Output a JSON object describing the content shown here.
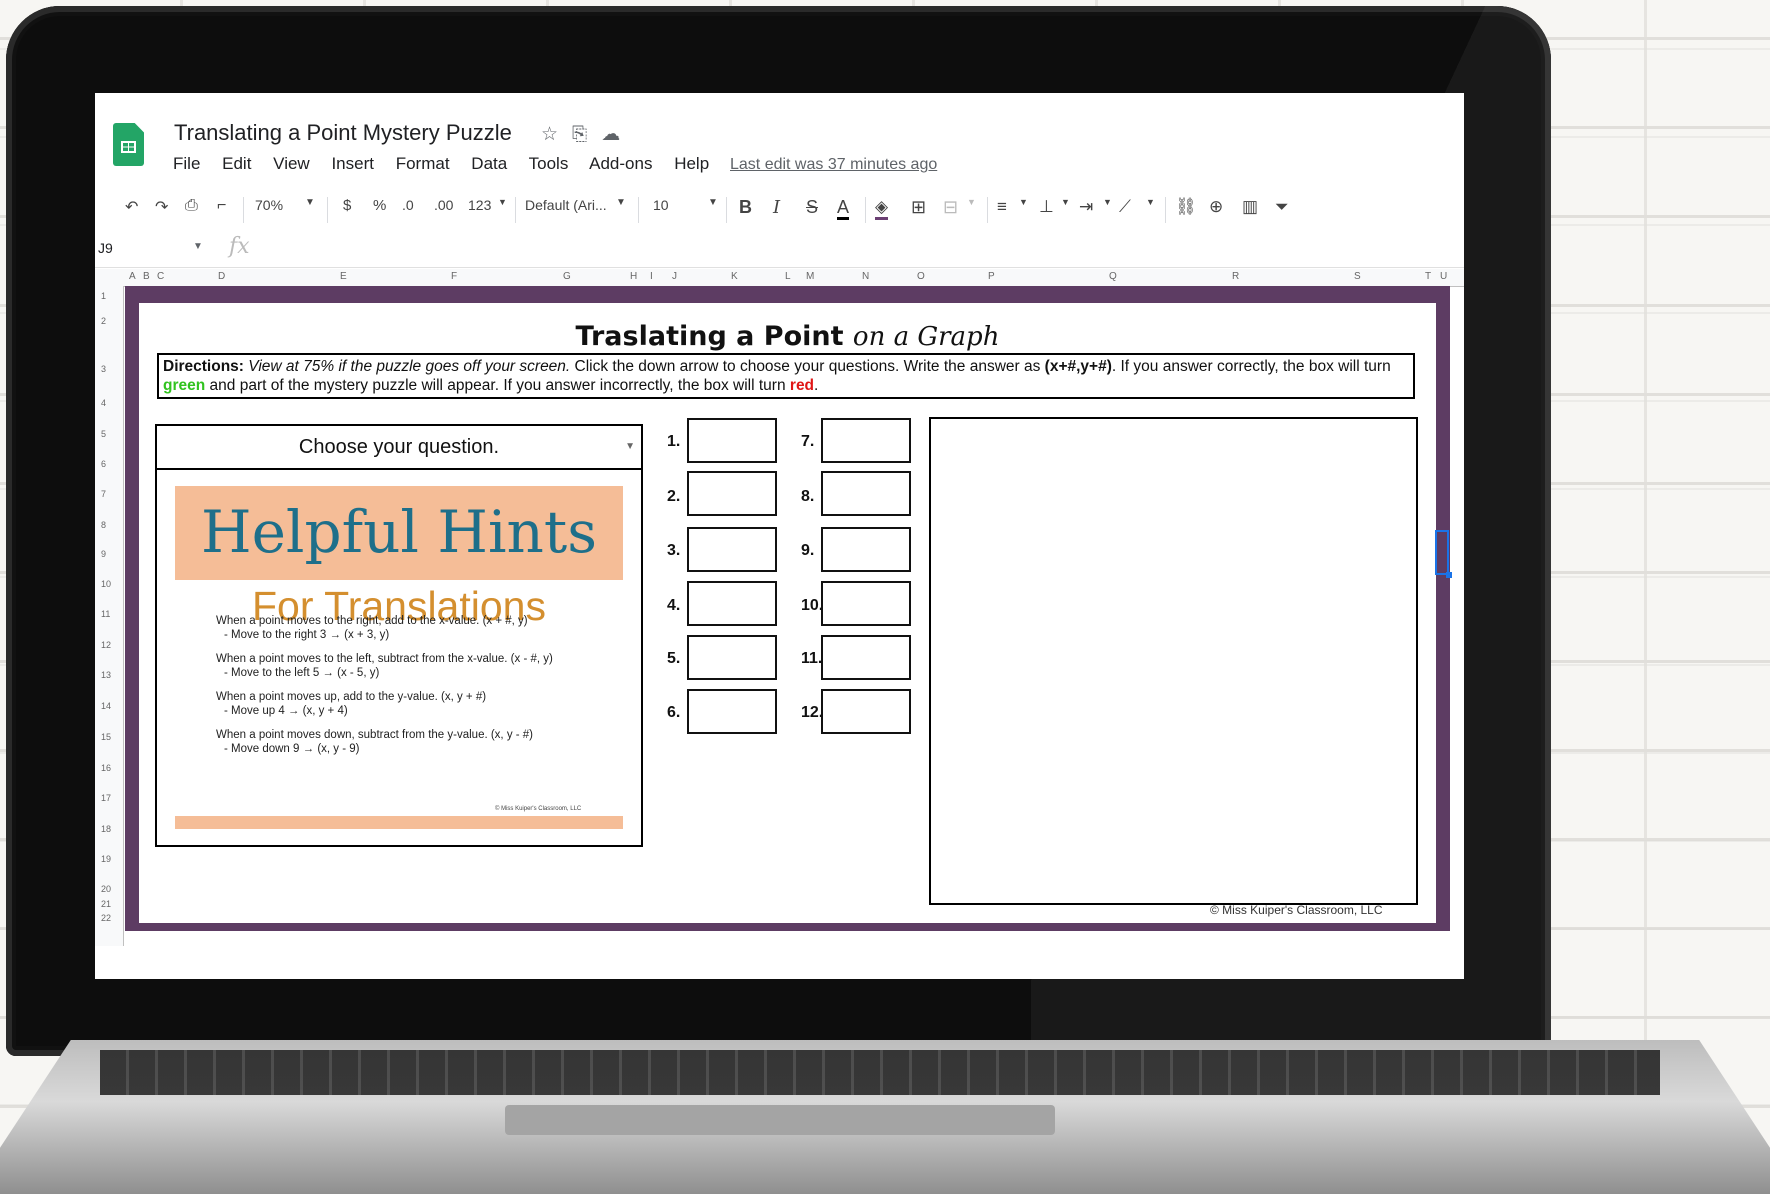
{
  "app": {
    "doc_title": "Translating a Point Mystery Puzzle",
    "title_icons": [
      "star-icon",
      "move-folder-icon",
      "cloud-status-icon"
    ],
    "menus": [
      "File",
      "Edit",
      "View",
      "Insert",
      "Format",
      "Data",
      "Tools",
      "Add-ons",
      "Help"
    ],
    "last_edit": "Last edit was 37 minutes ago"
  },
  "toolbar": {
    "zoom": "70%",
    "currency": "$",
    "percent": "%",
    "decrease_decimal": ".0",
    "increase_decimal": ".00",
    "more_formats": "123",
    "font": "Default (Ari...",
    "font_size": "10",
    "bold": "B",
    "italic": "I",
    "strike": "S",
    "text_color": "A",
    "fill_color": "#6b3f73"
  },
  "formula_bar": {
    "cell_ref": "J9",
    "fx": "fx",
    "value": ""
  },
  "grid": {
    "columns": [
      "A",
      "B",
      "C",
      "D",
      "E",
      "F",
      "G",
      "H",
      "I",
      "J",
      "K",
      "L",
      "M",
      "N",
      "O",
      "P",
      "Q",
      "R",
      "S",
      "T",
      "U"
    ],
    "rows": [
      "1",
      "2",
      "3",
      "4",
      "5",
      "6",
      "7",
      "8",
      "9",
      "10",
      "11",
      "12",
      "13",
      "14",
      "15",
      "16",
      "17",
      "18",
      "19",
      "20",
      "21",
      "22"
    ]
  },
  "puzzle": {
    "title_main": "Traslating a Point",
    "title_script": "on a Graph",
    "directions": {
      "label": "Directions:",
      "italic": "View at 75% if the puzzle goes off your screen.",
      "text1": "Click the down arrow to choose your questions. Write the answer as",
      "format": "(x+#,y+#)",
      "text2": ". If you answer correctly, the box will turn",
      "green": "green",
      "text3": "and part of the mystery puzzle will appear. If you answer incorrectly, the box will turn",
      "red": "red",
      "end": "."
    },
    "question_select": "Choose your question.",
    "hints": {
      "heading": "Helpful Hints",
      "subheading": "For Translations",
      "items": [
        {
          "rule": "When a point moves to the right, add to the x-value. (x + #, y)",
          "example": "-   Move to the right 3 → (x + 3, y)"
        },
        {
          "rule": "When a point moves to the left, subtract from the x-value. (x - #, y)",
          "example": "-   Move to the left 5 → (x - 5, y)"
        },
        {
          "rule": "When a point moves up, add to the y-value. (x, y + #)",
          "example": "-   Move up 4 → (x, y + 4)"
        },
        {
          "rule": "When a point moves down, subtract from the y-value. (x, y - #)",
          "example": "-   Move down 9 → (x, y - 9)"
        }
      ],
      "copyright": "© Miss Kuiper's Classroom, LLC"
    },
    "answer_labels": [
      "1.",
      "2.",
      "3.",
      "4.",
      "5.",
      "6.",
      "7.",
      "8.",
      "9.",
      "10.",
      "11.",
      "12."
    ],
    "answers": [
      "",
      "",
      "",
      "",
      "",
      "",
      "",
      "",
      "",
      "",
      "",
      ""
    ],
    "copyright": "© Miss Kuiper's Classroom, LLC"
  }
}
